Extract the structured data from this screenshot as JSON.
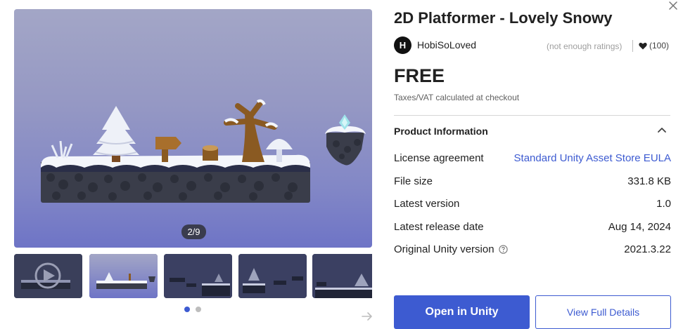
{
  "product": {
    "title": "2D Platformer - Lovely Snowy",
    "publisher_initial": "H",
    "publisher": "HobiSoLoved",
    "ratings_text": "(not enough ratings)",
    "favorites": "(100)",
    "price": "FREE",
    "tax_note": "Taxes/VAT calculated at checkout"
  },
  "gallery": {
    "counter": "2/9",
    "current_index": 2,
    "total": 9,
    "thumbnails": [
      {
        "label": "video-thumbnail",
        "is_video": true
      },
      {
        "label": "screenshot-2",
        "is_video": false,
        "selected": true
      },
      {
        "label": "screenshot-3",
        "is_video": false
      },
      {
        "label": "screenshot-4",
        "is_video": false
      },
      {
        "label": "screenshot-5",
        "is_video": false
      }
    ],
    "pages": 2,
    "current_page": 1
  },
  "product_info": {
    "heading": "Product Information",
    "rows": [
      {
        "key": "License agreement",
        "value": "Standard Unity Asset Store EULA",
        "is_link": true
      },
      {
        "key": "File size",
        "value": "331.8 KB"
      },
      {
        "key": "Latest version",
        "value": "1.0"
      },
      {
        "key": "Latest release date",
        "value": "Aug 14, 2024"
      },
      {
        "key": "Original Unity version",
        "value": "2021.3.22",
        "has_help": true
      }
    ]
  },
  "actions": {
    "open_in_unity": "Open in Unity",
    "view_full_details": "View Full Details"
  },
  "icons": [
    "close-icon",
    "heart-icon",
    "chevron-up-icon",
    "help-circle-icon",
    "arrow-right-icon",
    "play-icon"
  ],
  "colors": {
    "accent": "#3d5bd1",
    "counter_bg": "#3a3c4e",
    "sky_top": "#a3a6c6",
    "sky_bottom": "#6e74c6"
  }
}
